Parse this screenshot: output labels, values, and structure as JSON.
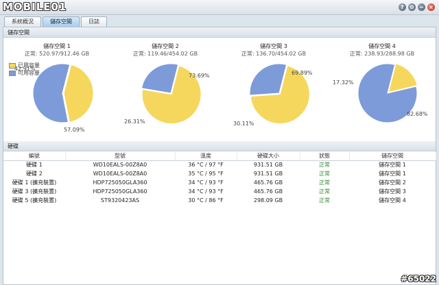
{
  "app": {
    "logo_text": "MOBILE01",
    "watermark": "#65022"
  },
  "window_buttons": [
    "?",
    "⚙",
    "−",
    "×"
  ],
  "tabs": [
    {
      "label": "系統概況",
      "active": false
    },
    {
      "label": "儲存空間",
      "active": true
    },
    {
      "label": "日誌",
      "active": false
    }
  ],
  "storage": {
    "header": "儲存空間",
    "legend": {
      "used": "已用容量",
      "free": "可用容量"
    },
    "colors": {
      "used": "#f5d75e",
      "free": "#7d9bd8"
    },
    "volumes": [
      {
        "name": "儲存空間 1",
        "status": "正常:",
        "capacity": "520.97/912.46 GB",
        "used_label": "42.91%",
        "free_label": "57.09%",
        "used_pct": 42.91
      },
      {
        "name": "儲存空間 2",
        "status": "正常:",
        "capacity": "119.46/454.02 GB",
        "used_label": "73.69%",
        "free_label": "26.31%",
        "used_pct": 73.69
      },
      {
        "name": "儲存空間 3",
        "status": "正常:",
        "capacity": "136.70/454.02 GB",
        "used_label": "69.89%",
        "free_label": "30.11%",
        "used_pct": 69.89
      },
      {
        "name": "儲存空間 4",
        "status": "正常:",
        "capacity": "238.93/288.98 GB",
        "used_label": "17.32%",
        "free_label": "82.68%",
        "used_pct": 17.32
      }
    ]
  },
  "disks": {
    "header": "硬碟",
    "columns": [
      "編號",
      "型號",
      "溫度",
      "硬碟大小",
      "狀態",
      "儲存空間"
    ],
    "rows": [
      [
        "硬碟 1",
        "WD10EALS-00Z8A0",
        "36 °C / 97 °F",
        "931.51 GB",
        "正常",
        "儲存空間 1"
      ],
      [
        "硬碟 2",
        "WD10EALS-00Z8A0",
        "35 °C / 95 °F",
        "931.51 GB",
        "正常",
        "儲存空間 1"
      ],
      [
        "硬碟 1 (擴充裝置)",
        "HDP725050GLA360",
        "34 °C / 93 °F",
        "465.76 GB",
        "正常",
        "儲存空間 2"
      ],
      [
        "硬碟 3 (擴充裝置)",
        "HDP725050GLA360",
        "34 °C / 93 °F",
        "465.76 GB",
        "正常",
        "儲存空間 3"
      ],
      [
        "硬碟 5 (擴充裝置)",
        "ST9320423AS",
        "30 °C / 86 °F",
        "298.09 GB",
        "正常",
        "儲存空間 4"
      ]
    ]
  }
}
